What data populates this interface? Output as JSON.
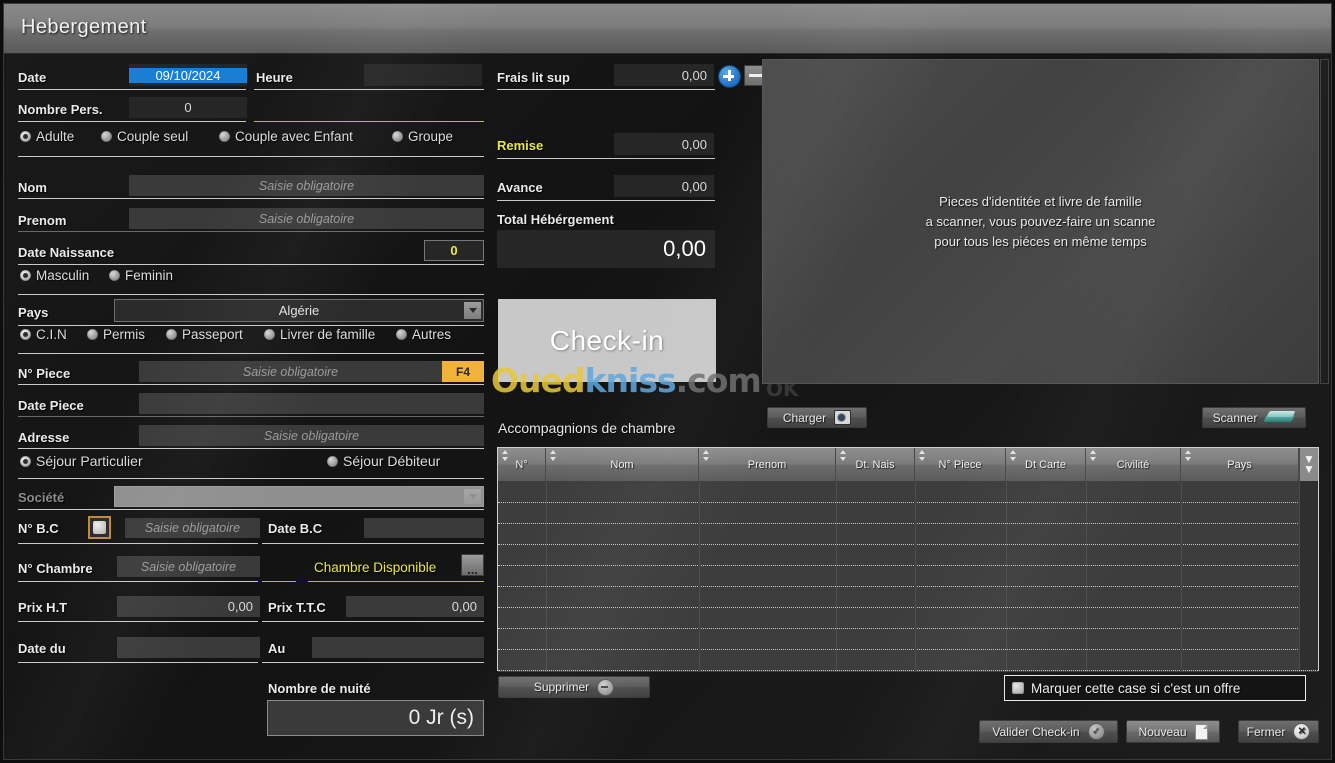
{
  "window": {
    "title": "Hebergement"
  },
  "left": {
    "date": {
      "label": "Date",
      "value": "09/10/2024"
    },
    "heure": {
      "label": "Heure",
      "value": ""
    },
    "nombre_pers": {
      "label": "Nombre Pers.",
      "value": "0"
    },
    "occupancy_radios": [
      {
        "label": "Adulte",
        "checked": true
      },
      {
        "label": "Couple seul",
        "checked": false
      },
      {
        "label": "Couple avec Enfant",
        "checked": false
      },
      {
        "label": "Groupe",
        "checked": false
      }
    ],
    "nom": {
      "label": "Nom",
      "placeholder": "Saisie obligatoire",
      "value": ""
    },
    "prenom": {
      "label": "Prenom",
      "placeholder": "Saisie obligatoire",
      "value": ""
    },
    "date_naissance": {
      "label": "Date Naissance",
      "value": "0"
    },
    "gender_radios": [
      {
        "label": "Masculin",
        "checked": true
      },
      {
        "label": "Feminin",
        "checked": false
      }
    ],
    "pays": {
      "label": "Pays",
      "value": "Algérie"
    },
    "doc_radios": [
      {
        "label": "C.I.N",
        "checked": true
      },
      {
        "label": "Permis",
        "checked": false
      },
      {
        "label": "Passeport",
        "checked": false
      },
      {
        "label": "Livrer de famille",
        "checked": false
      },
      {
        "label": "Autres",
        "checked": false
      }
    ],
    "n_piece": {
      "label": "N° Piece",
      "placeholder": "Saisie obligatoire",
      "value": "",
      "hotkey": "F4"
    },
    "date_piece": {
      "label": "Date Piece",
      "value": ""
    },
    "adresse": {
      "label": "Adresse",
      "placeholder": "Saisie obligatoire",
      "value": ""
    },
    "sejour_radios": [
      {
        "label": "Séjour Particulier",
        "checked": true
      },
      {
        "label": "Séjour Débiteur",
        "checked": false
      }
    ],
    "societe": {
      "label": "Société",
      "value": ""
    },
    "n_bc": {
      "label": "N° B.C",
      "placeholder": "Saisie obligatoire",
      "value": "",
      "checked": false
    },
    "date_bc": {
      "label": "Date B.C",
      "value": ""
    },
    "n_chambre": {
      "label": "N° Chambre",
      "placeholder": "Saisie obligatoire",
      "value": ""
    },
    "chambre_disponible": {
      "label": "Chambre Disponible",
      "more_button": "..."
    },
    "prix_ht": {
      "label": "Prix H.T",
      "value": "0,00"
    },
    "prix_ttc": {
      "label": "Prix T.T.C",
      "value": "0,00"
    },
    "date_du": {
      "label": "Date du",
      "value": ""
    },
    "au": {
      "label": "Au",
      "value": ""
    },
    "nombre_nuite": {
      "label": "Nombre de nuité",
      "value": "0 Jr (s)"
    }
  },
  "middle": {
    "frais_lit_sup": {
      "label": "Frais lit sup",
      "value": "0,00"
    },
    "add_button_icon": "plus-circle-icon",
    "remove_button_icon": "minus-icon",
    "remise": {
      "label": "Remise",
      "value": "0,00"
    },
    "avance": {
      "label": "Avance",
      "value": "0,00"
    },
    "total": {
      "label": "Total Hébérgement",
      "value": "0,00"
    },
    "checkin_button": "Check-in",
    "accompagnions_title": "Accompagnions de chambre"
  },
  "right": {
    "scan_hint_lines": [
      "Pieces d'identitée et livre de famille",
      "a scanner, vous pouvez-faire un scanne",
      "pour tous les piéces en même temps"
    ],
    "charger_button": "Charger",
    "scanner_button": "Scanner"
  },
  "table": {
    "columns": [
      "N°",
      "Nom",
      "Prenom",
      "Dt. Nais",
      "N° Piece",
      "Dt Carte",
      "Civilité",
      "Pays"
    ],
    "rows": []
  },
  "footer": {
    "supprimer_button": "Supprimer",
    "offer_checkbox_label": "Marquer cette case si c'est un offre",
    "offer_checked": false,
    "valider_button": "Valider Check-in",
    "nouveau_button": "Nouveau",
    "fermer_button": "Fermer"
  },
  "watermark": {
    "part1": "Oued",
    "part2": "kniss",
    "part3": ".com",
    "small": "OK"
  }
}
